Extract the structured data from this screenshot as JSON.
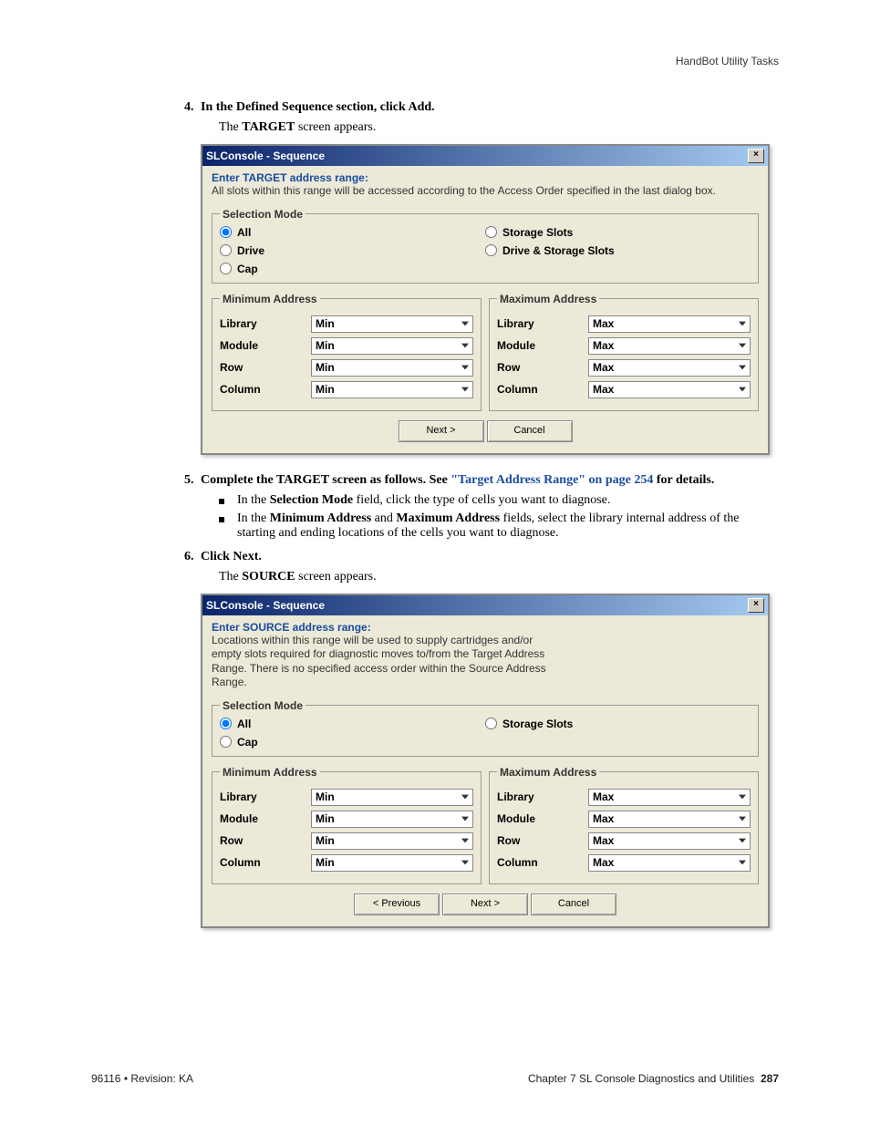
{
  "header": {
    "section_title": "HandBot Utility Tasks"
  },
  "steps": {
    "s4": {
      "num": "4.",
      "text": "In the Defined Sequence section, click Add."
    },
    "s4_after": {
      "pre": "The ",
      "bold": "TARGET",
      "post": " screen appears."
    },
    "s5": {
      "num": "5.",
      "pre": "Complete the TARGET screen as follows. See ",
      "link": "\"Target Address Range\" on page 254",
      "post": " for details."
    },
    "s5_b1": {
      "pre": "In the ",
      "bold": "Selection Mode",
      "post": " field, click the type of cells you want to diagnose."
    },
    "s5_b2": {
      "pre": "In the ",
      "bold1": "Minimum Address",
      "mid": " and ",
      "bold2": "Maximum Address",
      "post": " fields, select the library internal address of the starting and ending locations of the cells you want to diagnose."
    },
    "s6": {
      "num": "6.",
      "text": "Click Next."
    },
    "s6_after": {
      "pre": "The ",
      "bold": "SOURCE",
      "post": " screen appears."
    }
  },
  "dialog_target": {
    "title": "SLConsole - Sequence",
    "close": "×",
    "intro_title": "Enter TARGET address range:",
    "intro_text": "All slots within this range will be accessed according to the Access Order specified in the last dialog box.",
    "selection_mode_legend": "Selection Mode",
    "radios": {
      "all": "All",
      "drive": "Drive",
      "cap": "Cap",
      "storage": "Storage Slots",
      "drive_storage": "Drive & Storage Slots"
    },
    "min_legend": "Minimum Address",
    "max_legend": "Maximum Address",
    "rows": {
      "library": "Library",
      "module": "Module",
      "row": "Row",
      "column": "Column"
    },
    "min_val": "Min",
    "max_val": "Max",
    "buttons": {
      "next": "Next >",
      "cancel": "Cancel"
    }
  },
  "dialog_source": {
    "title": "SLConsole - Sequence",
    "close": "×",
    "intro_title": "Enter SOURCE address range:",
    "intro_text": "Locations within this range will be used to supply cartridges and/or empty slots required for diagnostic moves to/from the Target Address Range. There is no specified access order within the Source Address Range.",
    "selection_mode_legend": "Selection Mode",
    "radios": {
      "all": "All",
      "cap": "Cap",
      "storage": "Storage Slots"
    },
    "min_legend": "Minimum Address",
    "max_legend": "Maximum Address",
    "rows": {
      "library": "Library",
      "module": "Module",
      "row": "Row",
      "column": "Column"
    },
    "min_val": "Min",
    "max_val": "Max",
    "buttons": {
      "prev": "< Previous",
      "next": "Next >",
      "cancel": "Cancel"
    }
  },
  "footer": {
    "left": "96116 • Revision: KA",
    "right_pre": "Chapter 7 SL Console Diagnostics and Utilities",
    "page": "287"
  }
}
